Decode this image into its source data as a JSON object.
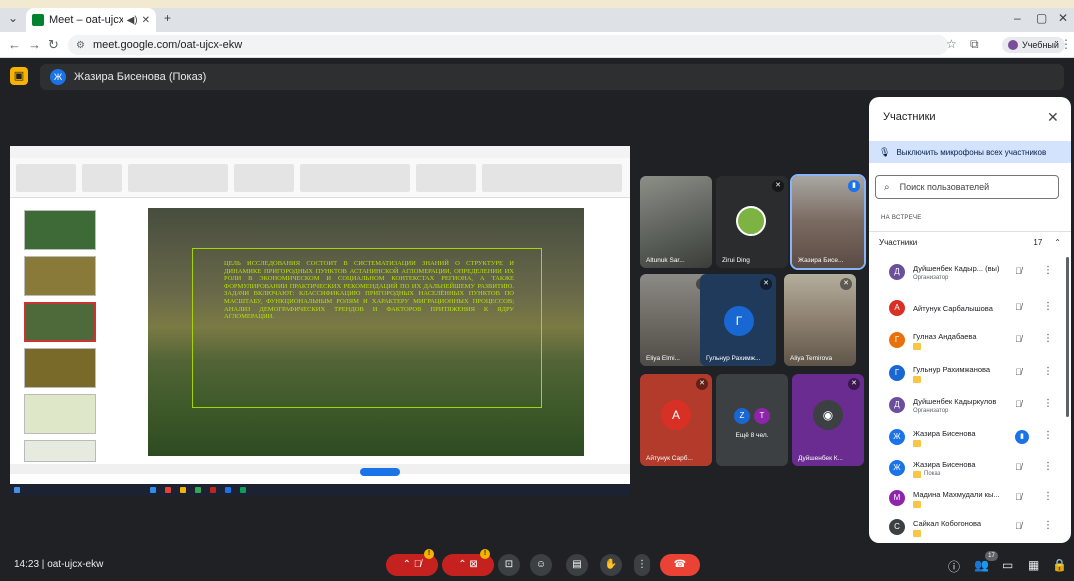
{
  "browser": {
    "tab_title": "Meet – oat-ujcx-ekw",
    "url": "meet.google.com/oat-ujcx-ekw",
    "profile_label": "Учебный"
  },
  "meet": {
    "presenter_label": "Жазира Бисенова (Показ)",
    "presenter_initial": "Ж",
    "meeting_time": "14:23",
    "meeting_code": "oat-ujcx-ekw"
  },
  "slide": {
    "text": "Цель исследования состоит в систематизации знаний о структуре и динамике пригородных пунктов Астанинской агломерации, определении их роли в экономическом и социальном контекстах региона, а также формулировании практических рекомендаций по их дальнейшему развитию. Задачи включают: классификацию пригородных населённых пунктов по масштабу, функциональным ролям и характеру миграционных процессов; анализ демографических трендов и факторов притяжения к ядру агломерации."
  },
  "tiles": [
    {
      "name": "Altunuk Sar..."
    },
    {
      "name": "Zirui Ding"
    },
    {
      "name": "Жазира Бисе..."
    },
    {
      "name": "Eliya Elmi..."
    },
    {
      "name": "Гульнур Рахимж...",
      "initial": "Г"
    },
    {
      "name": "Aliya Temirova"
    },
    {
      "name": "Айтунук Сарб...",
      "initial": "А"
    },
    {
      "more_label": "Ещё 8 чел.",
      "initial_a": "Z",
      "initial_b": "T"
    },
    {
      "name": "Дуйшенбек К..."
    }
  ],
  "panel": {
    "title": "Участники",
    "mute_all_label": "Выключить микрофоны всех участников",
    "search_placeholder": "Поиск пользователей",
    "section_label": "НА ВСТРЕЧЕ",
    "group_label": "Участники",
    "group_count": "17",
    "people": [
      {
        "name": "Дуйшенбек Кадыр... (вы)",
        "sub": "Организатор",
        "initial": "Д",
        "color": "#6b4f9c"
      },
      {
        "name": "Айтунук Сарбалышова",
        "initial": "А",
        "color": "#d93025"
      },
      {
        "name": "Гулназ Андабаева",
        "initial": "Г",
        "color": "#e8710a"
      },
      {
        "name": "Гульнур Рахимжанова",
        "initial": "Г",
        "color": "#1967d2"
      },
      {
        "name": "Дуйшенбек Кадыркулов",
        "sub": "Организатор",
        "initial": "Д",
        "color": "#6b4f9c"
      },
      {
        "name": "Жазира Бисенова",
        "initial": "Ж",
        "color": "#1a73e8"
      },
      {
        "name": "Жазира Бисенова",
        "sub": "Показ",
        "initial": "Ж",
        "color": "#1a73e8"
      },
      {
        "name": "Мадина Махмудали кы...",
        "initial": "М",
        "color": "#8e24aa"
      },
      {
        "name": "Сайкал Кобогонова",
        "initial": "С",
        "color": "#3c4043"
      }
    ]
  },
  "bottom": {
    "people_count": "17",
    "warn_glyph": "!"
  },
  "colors": {
    "accent": "#1a73e8",
    "end_call": "#ea4335",
    "warning": "#f6b400"
  }
}
